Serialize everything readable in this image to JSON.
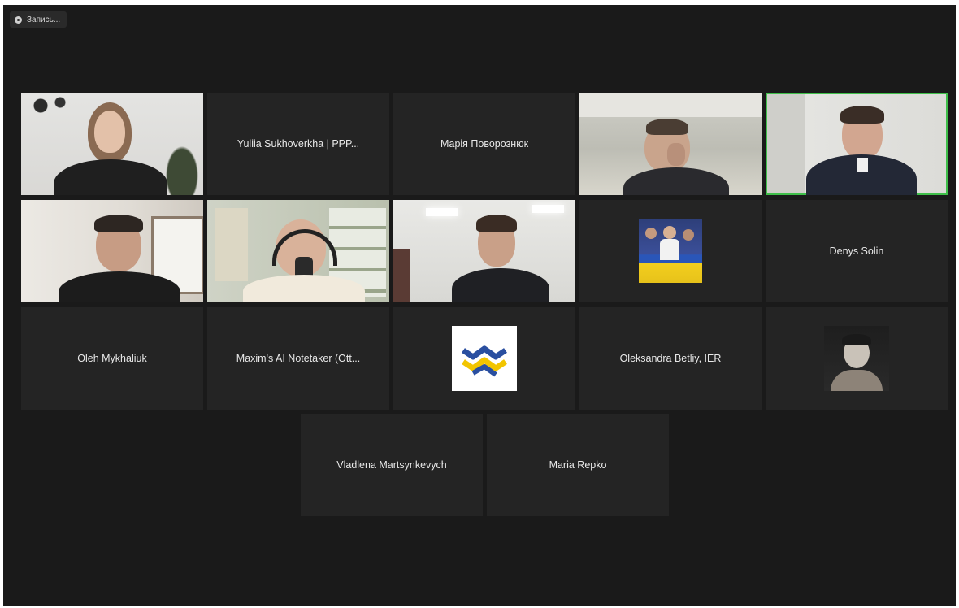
{
  "recording": {
    "label": "Запись..."
  },
  "participants": [
    {
      "name": "",
      "type": "video",
      "scene": "woman-office"
    },
    {
      "name": "Yuliia Sukhoverkha | PPP...",
      "type": "name"
    },
    {
      "name": "Марія Поворознюк",
      "type": "name"
    },
    {
      "name": "",
      "type": "video",
      "scene": "man-hand-face"
    },
    {
      "name": "",
      "type": "video",
      "scene": "man-suit",
      "active": true
    },
    {
      "name": "",
      "type": "video",
      "scene": "man-window"
    },
    {
      "name": "",
      "type": "video",
      "scene": "man-headphones"
    },
    {
      "name": "",
      "type": "video",
      "scene": "man-office"
    },
    {
      "name": "",
      "type": "avatar",
      "avatar": "group-photo"
    },
    {
      "name": "Denys Solin",
      "type": "name"
    },
    {
      "name": "Oleh Mykhaliuk",
      "type": "name"
    },
    {
      "name": "Maxim's AI Notetaker (Ott...",
      "type": "name"
    },
    {
      "name": "",
      "type": "avatar",
      "avatar": "logo"
    },
    {
      "name": "Oleksandra Betliy, IER",
      "type": "name"
    },
    {
      "name": "",
      "type": "avatar",
      "avatar": "portrait"
    },
    {
      "name": "Vladlena Martsynkevych",
      "type": "name"
    },
    {
      "name": "Maria Repko",
      "type": "name"
    }
  ],
  "colors": {
    "background": "#1a1a1a",
    "tile": "#242424",
    "active_border": "#3fbf4a",
    "logo_blue": "#2a4fa0",
    "logo_yellow": "#f2c500"
  }
}
